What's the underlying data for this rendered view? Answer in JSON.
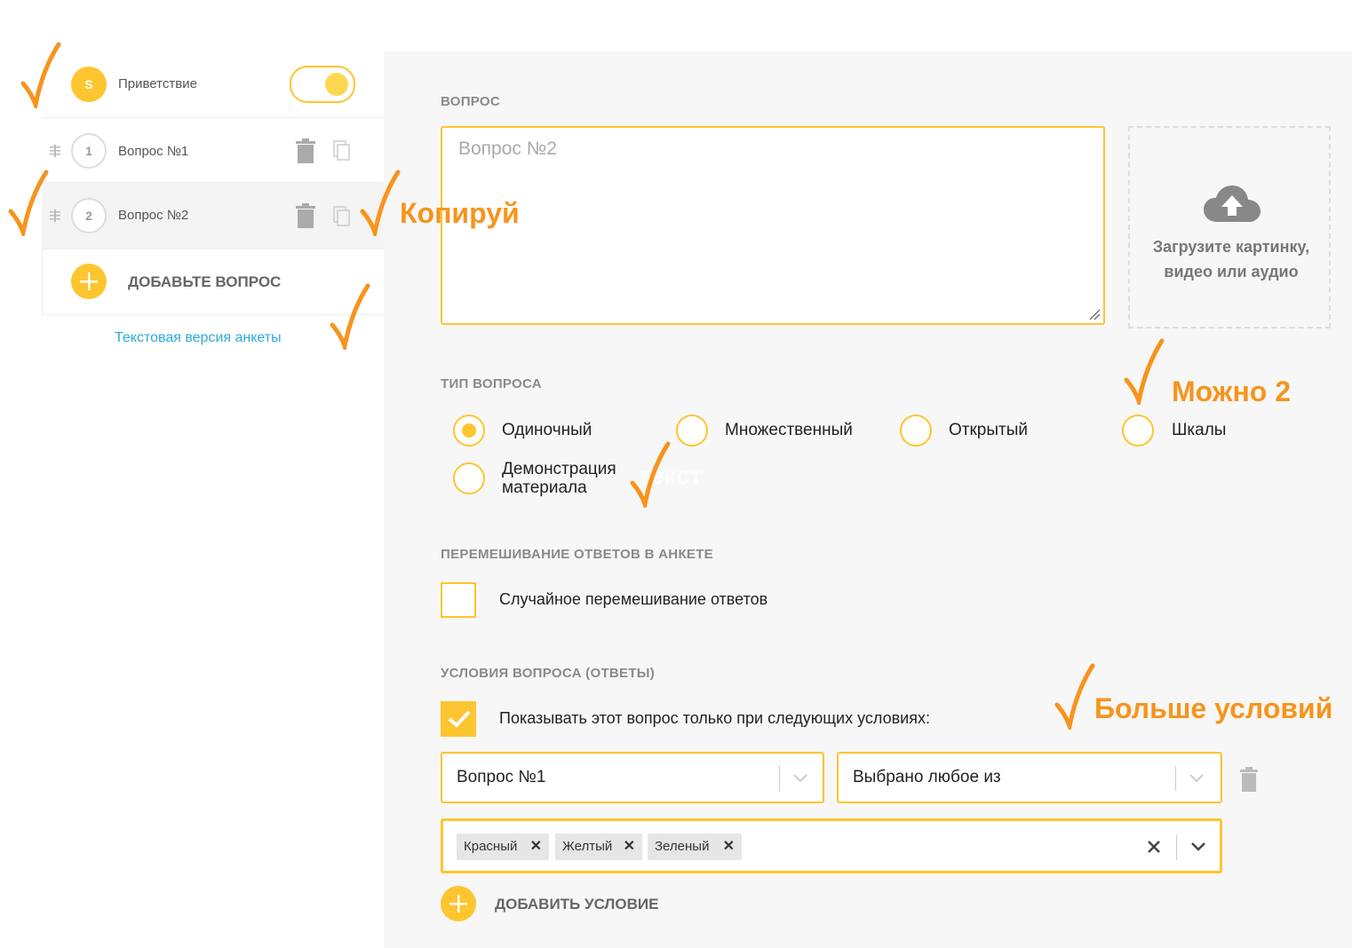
{
  "sidebar": {
    "greeting": {
      "avatar_letter": "S",
      "label": "Приветствие",
      "toggle_on": true
    },
    "questions": [
      {
        "number": "1",
        "label": "Вопрос №1"
      },
      {
        "number": "2",
        "label": "Вопрос №2"
      }
    ],
    "add_question_label": "ДОБАВЬТЕ ВОПРОС",
    "text_version_link": "Текстовая версия анкеты"
  },
  "main": {
    "question_section_label": "ВОПРОС",
    "question_placeholder": "Вопрос №2",
    "upload_text_line1": "Загрузите картинку,",
    "upload_text_line2": "видео или аудио",
    "type_section_label": "ТИП ВОПРОСА",
    "types": [
      {
        "label": "Одиночный",
        "selected": true
      },
      {
        "label": "Множественный",
        "selected": false
      },
      {
        "label": "Открытый",
        "selected": false
      },
      {
        "label": "Шкалы",
        "selected": false
      },
      {
        "label_line1": "Демонстрация",
        "label_line2": "материала",
        "selected": false
      }
    ],
    "shuffle_section_label": "ПЕРЕМЕШИВАНИЕ ОТВЕТОВ В АНКЕТЕ",
    "shuffle_checkbox_label": "Случайное перемешивание ответов",
    "shuffle_checked": false,
    "conditions_section_label": "УСЛОВИЯ ВОПРОСА (ОТВЕТЫ)",
    "conditions_checkbox_label": "Показывать этот вопрос только при следующих условиях:",
    "conditions_checked": true,
    "condition_question_value": "Вопрос №1",
    "condition_operator_value": "Выбрано любое из",
    "condition_tags": [
      "Красный",
      "Желтый",
      "Зеленый"
    ],
    "add_condition_label": "ДОБАВИТЬ УСЛОВИЕ"
  },
  "annotations": {
    "copy": "Копируй",
    "two_allowed": "Можно 2",
    "more_conditions": "Больше условий",
    "faded_text": "текст"
  },
  "colors": {
    "accent": "#fdc52f",
    "annotation": "#f7941d",
    "link": "#2eaadc"
  },
  "icons": [
    "drag-handle-icon",
    "trash-icon",
    "copy-icon",
    "plus-icon",
    "cloud-upload-icon",
    "chevron-down-icon",
    "clear-icon",
    "checkmark-icon"
  ]
}
